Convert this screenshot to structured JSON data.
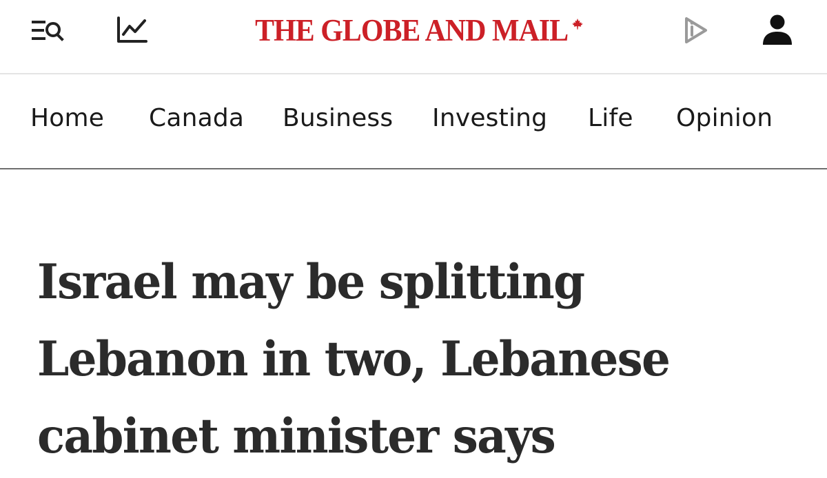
{
  "header": {
    "logo_text": "THE GLOBE AND MAIL",
    "logo_mark": "maple-leaf-icon",
    "icons": {
      "menu_search": "menu-search-icon",
      "markets": "chart-line-icon",
      "video": "play-video-icon",
      "account": "user-icon"
    }
  },
  "nav": {
    "items": [
      "Home",
      "Canada",
      "Business",
      "Investing",
      "Life",
      "Opinion"
    ]
  },
  "article": {
    "headline_lines": [
      "Israel may be splitting",
      "Lebanon in two, Lebanese",
      "cabinet minister says"
    ]
  },
  "colors": {
    "brand_red": "#cc2027",
    "text_dark": "#2b2b2b",
    "divider": "#6e6e6e",
    "icon_gray": "#9a9a9a"
  }
}
